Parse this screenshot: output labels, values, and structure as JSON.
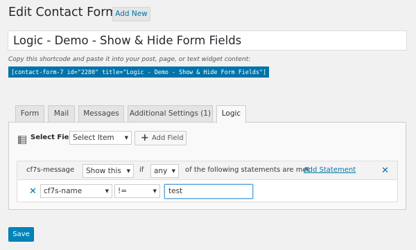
{
  "header": {
    "title": "Edit Contact Form",
    "add_new": "Add New"
  },
  "form_title": "Logic - Demo - Show & Hide Form Fields",
  "shortcode": {
    "description": "Copy this shortcode and paste it into your post, page, or text widget content:",
    "code": "[contact-form-7 id=\"2280\" title=\"Logic - Demo - Show & Hide Form Fields\"]"
  },
  "tabs": [
    {
      "label": "Form",
      "active": false
    },
    {
      "label": "Mail",
      "active": false
    },
    {
      "label": "Messages",
      "active": false
    },
    {
      "label": "Additional Settings (1)",
      "active": false
    },
    {
      "label": "Logic",
      "active": true
    }
  ],
  "logic": {
    "select_field_label": "Select Field",
    "select_item": "Select Item",
    "add_field": "Add Field",
    "rule": {
      "field_name": "cf7s-message",
      "action": "Show this",
      "if_label": "if",
      "quantifier": "any",
      "statements_text": "of the following statements are met",
      "add_statement": "Add Statement"
    },
    "statement": {
      "field": "cf7s-name",
      "operator": "!=",
      "value": "test"
    }
  },
  "save_label": "Save",
  "icons": {
    "close": "close-icon",
    "remove_statement": "remove-statement-icon",
    "list": "list-icon",
    "plus": "plus-icon"
  },
  "colors": {
    "accent": "#0073aa",
    "button_primary": "#0085ba",
    "background": "#f1f1f1"
  }
}
